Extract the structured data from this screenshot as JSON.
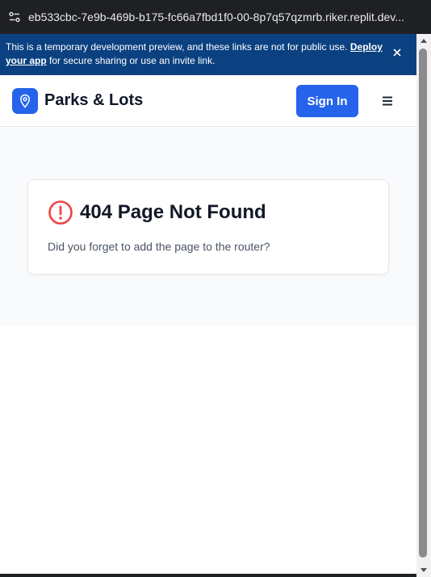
{
  "browser": {
    "url": "eb533cbc-7e9b-469b-b175-fc66a7fbd1f0-00-8p7q57qzmrb.riker.replit.dev..."
  },
  "banner": {
    "text_before": "This is a temporary development preview, and these links are not for public use. ",
    "link_text": "Deploy your app",
    "text_after": " for secure sharing or use an invite link."
  },
  "navbar": {
    "brand": "Parks & Lots",
    "signin_label": "Sign In"
  },
  "error_card": {
    "title": "404 Page Not Found",
    "message": "Did you forget to add the page to the router?"
  },
  "colors": {
    "banner_bg": "#0b4180",
    "accent": "#2563eb",
    "error_icon": "#ef4444"
  },
  "icons": {
    "site_info": "site-info-icon",
    "close": "close-icon",
    "logo": "map-pin-icon",
    "menu": "hamburger-menu-icon",
    "error": "alert-circle-icon"
  }
}
